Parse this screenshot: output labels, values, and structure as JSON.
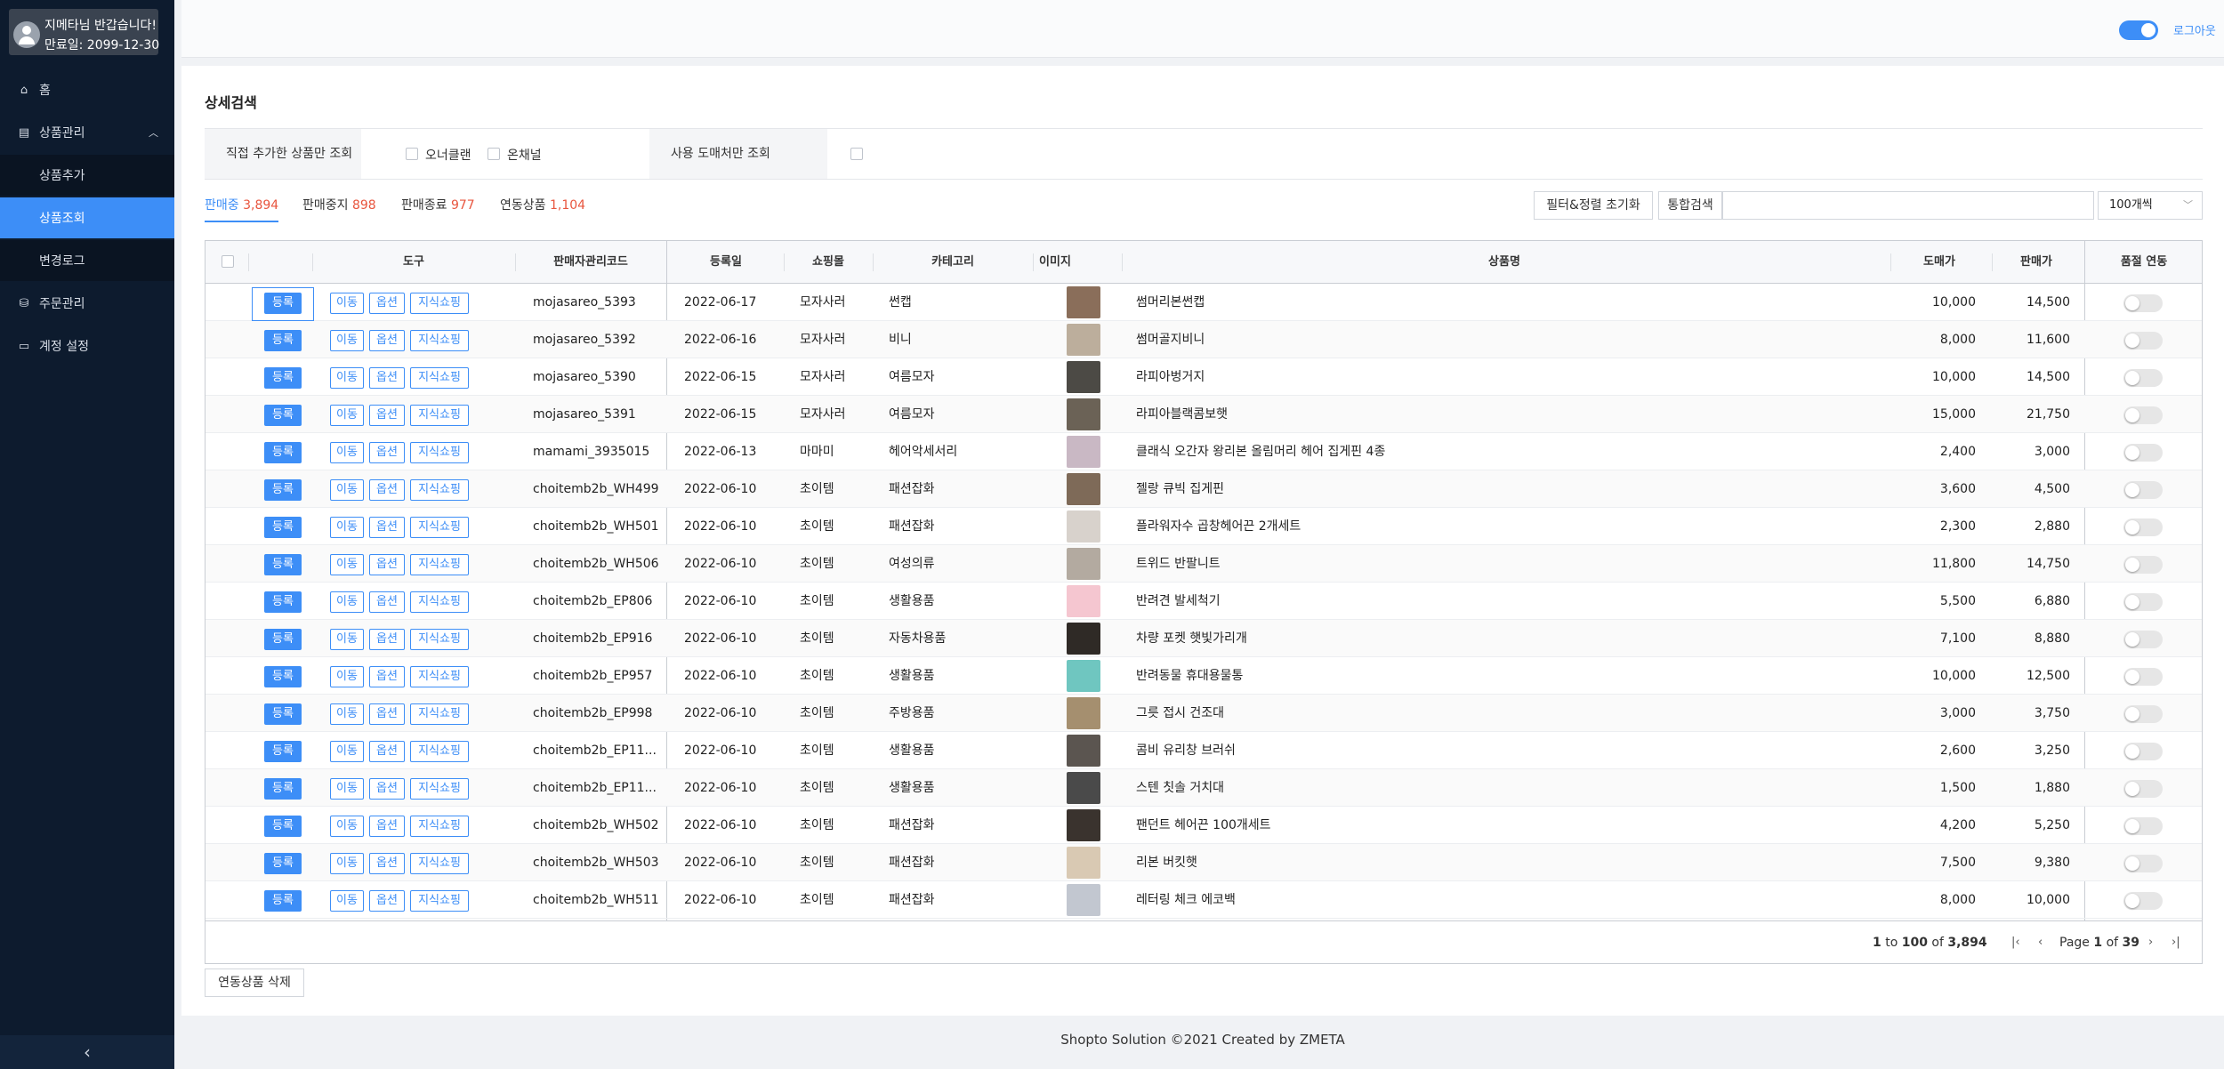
{
  "sidebar": {
    "greeting": "지메타님 반갑습니다!",
    "expiry": "만료일: 2099-12-30",
    "items": [
      {
        "label": "홈",
        "icon": "home-icon"
      },
      {
        "label": "상품관리",
        "icon": "product-icon"
      },
      {
        "label": "상품추가"
      },
      {
        "label": "상품조회"
      },
      {
        "label": "변경로그"
      },
      {
        "label": "주문관리",
        "icon": "bag-icon"
      },
      {
        "label": "계정 설정",
        "icon": "account-icon"
      }
    ],
    "collapse": "‹"
  },
  "topbar": {
    "logout": "로그아웃"
  },
  "page": {
    "title": "상세검색",
    "filter_own_label": "직접 추가한 상품만 조회",
    "filter_owner_clean": "오너클랜",
    "filter_on_channel": "온채널",
    "filter_wholesale_label": "사용 도매처만 조회"
  },
  "tabs": [
    {
      "label": "판매중",
      "count": "3,894"
    },
    {
      "label": "판매중지",
      "count": "898"
    },
    {
      "label": "판매종료",
      "count": "977"
    },
    {
      "label": "연동상품",
      "count": "1,104"
    }
  ],
  "toolbar": {
    "reset": "필터&정렬 초기화",
    "search_label": "통합검색",
    "search_value": "",
    "page_size": "100개씩"
  },
  "table": {
    "headers": {
      "tools": "도구",
      "code": "판매자관리코드",
      "date": "등록일",
      "mall": "쇼핑몰",
      "category": "카테고리",
      "image": "이미지",
      "name": "상품명",
      "wholesale": "도매가",
      "price": "판매가",
      "sync": "품절 연동"
    },
    "buttons": {
      "register": "등록",
      "move": "이동",
      "option": "옵션",
      "shopping": "지식쇼핑"
    },
    "rows": [
      {
        "code": "mojasareo_5393",
        "date": "2022-06-17",
        "mall": "모자사러",
        "category": "썬캡",
        "name": "썸머리본썬캡",
        "wholesale": "10,000",
        "price": "14,500"
      },
      {
        "code": "mojasareo_5392",
        "date": "2022-06-16",
        "mall": "모자사러",
        "category": "비니",
        "name": "썸머골지비니",
        "wholesale": "8,000",
        "price": "11,600"
      },
      {
        "code": "mojasareo_5390",
        "date": "2022-06-15",
        "mall": "모자사러",
        "category": "여름모자",
        "name": "라피아벙거지",
        "wholesale": "10,000",
        "price": "14,500"
      },
      {
        "code": "mojasareo_5391",
        "date": "2022-06-15",
        "mall": "모자사러",
        "category": "여름모자",
        "name": "라피아블랙콤보햇",
        "wholesale": "15,000",
        "price": "21,750"
      },
      {
        "code": "mamami_3935015",
        "date": "2022-06-13",
        "mall": "마마미",
        "category": "헤어악세서리",
        "name": "클래식 오간자 왕리본 올림머리 헤어 집게핀 4종",
        "wholesale": "2,400",
        "price": "3,000"
      },
      {
        "code": "choitemb2b_WH499",
        "date": "2022-06-10",
        "mall": "초이템",
        "category": "패션잡화",
        "name": "젤랑 큐빅 집게핀",
        "wholesale": "3,600",
        "price": "4,500"
      },
      {
        "code": "choitemb2b_WH501",
        "date": "2022-06-10",
        "mall": "초이템",
        "category": "패션잡화",
        "name": "플라워자수 곱창헤어끈 2개세트",
        "wholesale": "2,300",
        "price": "2,880"
      },
      {
        "code": "choitemb2b_WH506",
        "date": "2022-06-10",
        "mall": "초이템",
        "category": "여성의류",
        "name": "트위드 반팔니트",
        "wholesale": "11,800",
        "price": "14,750"
      },
      {
        "code": "choitemb2b_EP806",
        "date": "2022-06-10",
        "mall": "초이템",
        "category": "생활용품",
        "name": "반려견 발세척기",
        "wholesale": "5,500",
        "price": "6,880"
      },
      {
        "code": "choitemb2b_EP916",
        "date": "2022-06-10",
        "mall": "초이템",
        "category": "자동차용품",
        "name": "차량 포켓 햇빛가리개",
        "wholesale": "7,100",
        "price": "8,880"
      },
      {
        "code": "choitemb2b_EP957",
        "date": "2022-06-10",
        "mall": "초이템",
        "category": "생활용품",
        "name": "반려동물 휴대용물통",
        "wholesale": "10,000",
        "price": "12,500"
      },
      {
        "code": "choitemb2b_EP998",
        "date": "2022-06-10",
        "mall": "초이템",
        "category": "주방용품",
        "name": "그릇 접시 건조대",
        "wholesale": "3,000",
        "price": "3,750"
      },
      {
        "code": "choitemb2b_EP11...",
        "date": "2022-06-10",
        "mall": "초이템",
        "category": "생활용품",
        "name": "콤비 유리창 브러쉬",
        "wholesale": "2,600",
        "price": "3,250"
      },
      {
        "code": "choitemb2b_EP11...",
        "date": "2022-06-10",
        "mall": "초이템",
        "category": "생활용품",
        "name": "스텐 칫솔 거치대",
        "wholesale": "1,500",
        "price": "1,880"
      },
      {
        "code": "choitemb2b_WH502",
        "date": "2022-06-10",
        "mall": "초이템",
        "category": "패션잡화",
        "name": "팬던트 헤어끈 100개세트",
        "wholesale": "4,200",
        "price": "5,250"
      },
      {
        "code": "choitemb2b_WH503",
        "date": "2022-06-10",
        "mall": "초이템",
        "category": "패션잡화",
        "name": "리본 버킷햇",
        "wholesale": "7,500",
        "price": "9,380"
      },
      {
        "code": "choitemb2b_WH511",
        "date": "2022-06-10",
        "mall": "초이템",
        "category": "패션잡화",
        "name": "레터링 체크 에코백",
        "wholesale": "8,000",
        "price": "10,000"
      }
    ],
    "thumb_colors": [
      "#8a6e5a",
      "#bcae9c",
      "#4c4a45",
      "#6b6256",
      "#c9b8c4",
      "#7e6a58",
      "#d8d2cc",
      "#b3aaa0",
      "#f5c6d0",
      "#2f2a26",
      "#6fc6c0",
      "#a58f6f",
      "#5b5550",
      "#4a4a4a",
      "#3a332e",
      "#d9c9b3",
      "#c2c7d0"
    ]
  },
  "pagination": {
    "from": "1",
    "to": "100",
    "of_label": "to",
    "of2": "of",
    "total": "3,894",
    "page_label": "Page",
    "page": "1",
    "of3": "of",
    "pages": "39"
  },
  "bottom": {
    "delete_linked": "연동상품 삭제"
  },
  "footer": "Shopto Solution ©2021 Created by ZMETA"
}
